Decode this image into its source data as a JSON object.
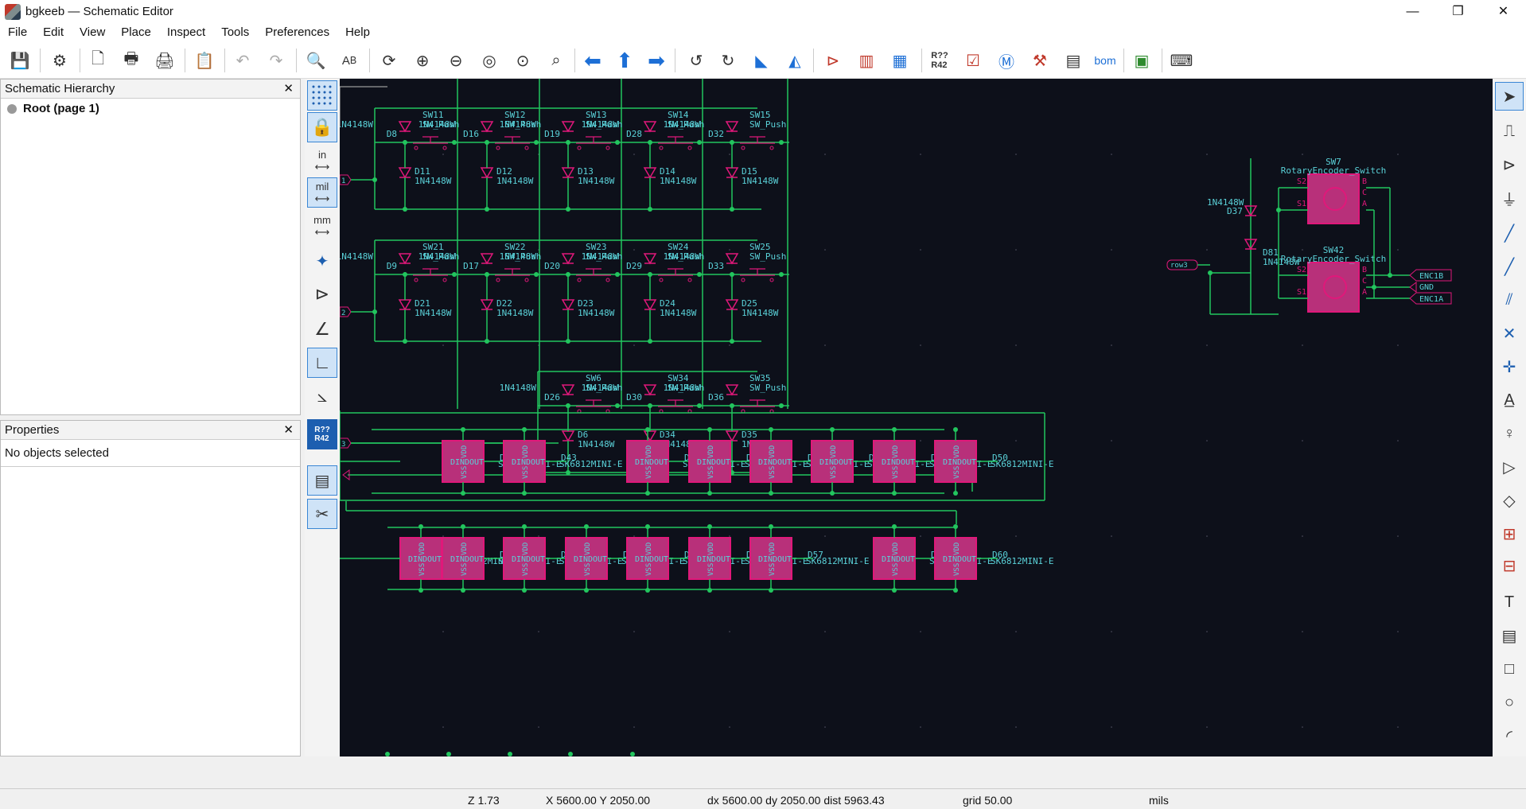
{
  "window": {
    "title": "bgkeeb — Schematic Editor",
    "controls": [
      "—",
      "❐",
      "✕"
    ]
  },
  "menu": [
    "File",
    "Edit",
    "View",
    "Place",
    "Inspect",
    "Tools",
    "Preferences",
    "Help"
  ],
  "panels": {
    "hierarchy": {
      "title": "Schematic Hierarchy",
      "root_label": "Root (page 1)"
    },
    "properties": {
      "title": "Properties",
      "empty_text": "No objects selected"
    }
  },
  "left_tool_labels": {
    "inch": "in",
    "mil": "mil",
    "mm": "mm",
    "annotate": "R??\nR42"
  },
  "status": {
    "zoom": "Z 1.73",
    "xy": "X 5600.00  Y 2050.00",
    "delta": "dx 5600.00  dy 2050.00  dist 5963.43",
    "grid": "grid 50.00",
    "units": "mils"
  },
  "colors": {
    "canvas_bg": "#0d101a",
    "wire": "#22c55e",
    "symbol": "#e0187a",
    "symbol_fill": "#c99bd1",
    "text": "#5ad1d8",
    "accent": "#3a86d4"
  },
  "schematic": {
    "row1": {
      "switches": [
        "SW11",
        "SW12",
        "SW13",
        "SW14",
        "SW15"
      ],
      "diodes_top": [
        "D8",
        "D16",
        "D19",
        "D28",
        "D32"
      ],
      "diodes_bottom": [
        "D11",
        "D12",
        "D13",
        "D14",
        "D15"
      ],
      "label": "1"
    },
    "row2": {
      "switches": [
        "SW21",
        "SW22",
        "SW23",
        "SW24",
        "SW25"
      ],
      "diodes_top": [
        "D9",
        "D17",
        "D20",
        "D29",
        "D33"
      ],
      "diodes_bottom": [
        "D21",
        "D22",
        "D23",
        "D24",
        "D25"
      ],
      "label": "2"
    },
    "row3": {
      "switches": [
        "SW6",
        "SW34",
        "SW35"
      ],
      "diodes_top": [
        "D26",
        "D30",
        "D36"
      ],
      "diodes_bottom": [
        "D6",
        "D34",
        "D35"
      ],
      "label": "3"
    },
    "switch_value": "SW_Push",
    "diode_value": "1N4148W",
    "encoders": [
      {
        "ref": "SW7",
        "value": "RotaryEncoder_Switch"
      },
      {
        "ref": "SW42",
        "value": "RotaryEncoder_Switch"
      }
    ],
    "encoder_diodes": [
      "D37",
      "D81"
    ],
    "net_labels": {
      "row3": "row3",
      "enc1b": "ENC1B",
      "gnd": "GND",
      "enc1a": "ENC1A"
    },
    "led_value": "SK6812MINI-E",
    "led_row1": [
      "D41",
      "D42",
      "D43",
      "D45",
      "D46",
      "D47",
      "D48",
      "D49",
      "D50"
    ],
    "led_row2": [
      "D51",
      "D52",
      "D53",
      "D54",
      "D55",
      "D56",
      "D57",
      "D59",
      "D60"
    ],
    "led_pins": {
      "din": "DIN",
      "dout": "DOUT",
      "vdd": "VDD",
      "vss": "VSS"
    }
  }
}
